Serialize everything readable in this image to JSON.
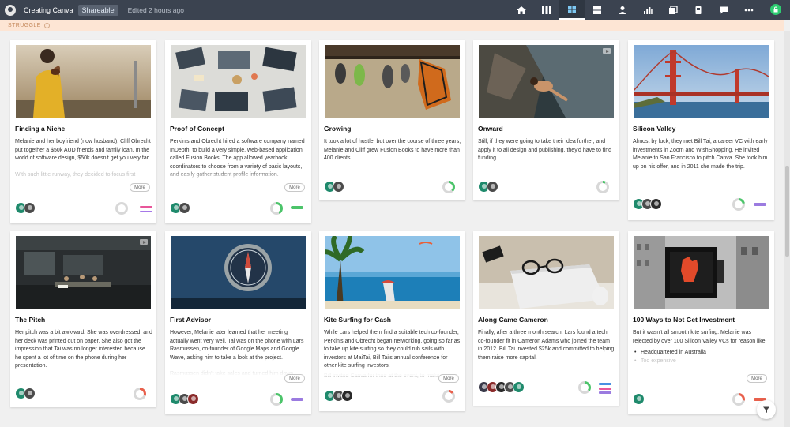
{
  "topbar": {
    "title": "Creating Canva",
    "share_label": "Shareable",
    "edited": "Edited 2 hours ago",
    "icons": [
      "home-icon",
      "columns-icon",
      "grid-icon",
      "rows-icon",
      "person-icon",
      "bar-chart-icon",
      "layers-icon",
      "book-icon",
      "comment-icon",
      "more-icon"
    ],
    "active_icon": "grid-icon",
    "lock_icon": "lock-icon",
    "colors": {
      "bar": "#3b4350",
      "lock": "#2ecc71"
    }
  },
  "banner": {
    "label": "STRUGGLE",
    "color": "#fde5d4"
  },
  "cards": [
    {
      "title": "Finding a Niche",
      "paragraphs": [
        "Melanie and her boyfriend (now husband), Cliff Obrecht put together a $50k AUD friends and family loan. In the world of software design, $50k doesn't get you very far."
      ],
      "faded": "With such little runway, they decided to focus first",
      "more": "More"
    },
    {
      "title": "Proof of Concept",
      "paragraphs": [
        "Perkin's and Obrecht hired a software company named InDepth, to build a very simple, web-based application called Fusion Books. The app allowed yearbook coordinators to choose from a variety of basic layouts, and easily gather student profile information."
      ],
      "faded": "",
      "more": "More"
    },
    {
      "title": "Growing",
      "paragraphs": [
        "It took a lot of hustle, but over the course of three years, Melanie and Cliff grew Fusion Books to have more than 400 clients."
      ],
      "faded": "",
      "more": ""
    },
    {
      "title": "Onward",
      "paragraphs": [
        "Still, if they were going to take their idea further, and apply it to all design and publishing, they'd have to find funding."
      ],
      "faded": "",
      "more": ""
    },
    {
      "title": "Silicon Valley",
      "paragraphs": [
        "Almost by luck, they met Bill Tai, a career VC with early investments in Zoom and WishShopping. He invited Melanie to San Francisco to pitch Canva. She took him up on his offer, and in 2011 she made the trip."
      ],
      "faded": "",
      "more": ""
    },
    {
      "title": "The Pitch",
      "paragraphs": [
        "Her pitch was a bit awkward. She was overdressed, and her deck was printed out on paper. She also got the impression that Tai was no longer interested because he spent a lot of time on the phone during her presentation."
      ],
      "faded": "",
      "more": ""
    },
    {
      "title": "First Advisor",
      "paragraphs": [
        "However, Melanie later learned that her meeting actually went very well. Tai was on the phone with Lars Rasmussen, co-founder of Google Maps and Google Wave, asking him to take a look at the project."
      ],
      "faded": "Rasmussen didn't take sales and turned him down",
      "more": "More"
    },
    {
      "title": "Kite Surfing for Cash",
      "paragraphs": [
        "While Lars helped them find a suitable tech co-founder, Perkin's and Obrecht began networking, going so far as to take up kite surfing so they could rub sails with investors at MaiTai, Bill Tai's annual conference for other kite surfing investors."
      ],
      "faded": "Bill invited Canva for their at the event, to make",
      "more": "More"
    },
    {
      "title": "Along Came Cameron",
      "paragraphs": [
        "Finally, after a three month search. Lars found a tech co-founder fit in Cameron Adams who joined the team in 2012. Bill Tai invested $25k and committed to helping them raise more capital."
      ],
      "faded": "",
      "more": ""
    },
    {
      "title": "100 Ways to Not Get Investment",
      "paragraphs": [
        "But it wasn't all smooth kite surfing. Melanie was rejected by over 100 Silicon Valley VCs for reason like:"
      ],
      "bullets": [
        "Headquartered in Australia",
        "Too expensive"
      ],
      "faded": "",
      "more": "More"
    }
  ],
  "filter": {
    "icon": "filter-icon"
  }
}
